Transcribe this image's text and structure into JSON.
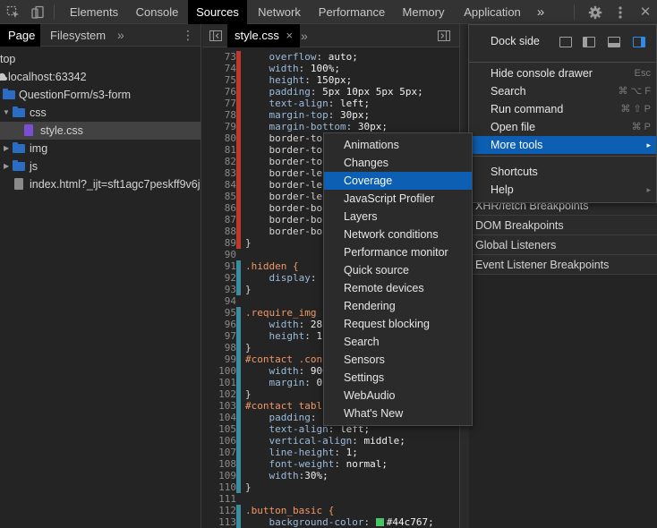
{
  "toolbar": {
    "inspect_icon": "cursor-inspect-icon",
    "device_icon": "device-toggle-icon",
    "tabs": [
      "Elements",
      "Console",
      "Sources",
      "Network",
      "Performance",
      "Memory",
      "Application"
    ],
    "active_tab": "Sources",
    "more_tabs": "»",
    "settings_icon": "gear-icon",
    "kebab_icon": "vertical-dots-icon",
    "close_icon": "close-icon",
    "close_glyph": "✕"
  },
  "navigator": {
    "tabs": [
      "Page",
      "Filesystem"
    ],
    "active_tab": "Page",
    "more": "»",
    "menu": "⋮",
    "tree": [
      {
        "label": "top",
        "level": 0,
        "kind": "frame"
      },
      {
        "label": "localhost:63342",
        "level": 0,
        "kind": "cloud"
      },
      {
        "label": "QuestionForm/s3-form",
        "level": 0,
        "kind": "folder"
      },
      {
        "label": "css",
        "level": 0,
        "kind": "folder",
        "open": true
      },
      {
        "label": "style.css",
        "level": 1,
        "kind": "css-file",
        "selected": true
      },
      {
        "label": "img",
        "level": 0,
        "kind": "folder",
        "open": false
      },
      {
        "label": "js",
        "level": 0,
        "kind": "folder",
        "open": false
      },
      {
        "label": "index.html?_ijt=sft1agc7peskff9v6j3",
        "level": 0,
        "kind": "html-file"
      }
    ]
  },
  "editor": {
    "tab_label": "style.css",
    "tab_close": "×",
    "lines": [
      {
        "n": "73",
        "cov": "red",
        "text": "    overflow: auto;"
      },
      {
        "n": "74",
        "cov": "red",
        "text": "    width: 100%;"
      },
      {
        "n": "75",
        "cov": "red",
        "text": "    height: 150px;"
      },
      {
        "n": "76",
        "cov": "red",
        "text": "    padding: 5px 10px 5px 5px;"
      },
      {
        "n": "77",
        "cov": "red",
        "text": "    text-align: left;"
      },
      {
        "n": "78",
        "cov": "red",
        "text": "    margin-top: 30px;"
      },
      {
        "n": "79",
        "cov": "red",
        "text": "    margin-bottom: 30px;"
      },
      {
        "n": "80",
        "cov": "red",
        "text": "    border-to"
      },
      {
        "n": "81",
        "cov": "red",
        "text": "    border-to"
      },
      {
        "n": "82",
        "cov": "red",
        "text": "    border-to"
      },
      {
        "n": "83",
        "cov": "red",
        "text": "    border-le"
      },
      {
        "n": "84",
        "cov": "red",
        "text": "    border-le"
      },
      {
        "n": "85",
        "cov": "red",
        "text": "    border-le"
      },
      {
        "n": "86",
        "cov": "red",
        "text": "    border-bo"
      },
      {
        "n": "87",
        "cov": "red",
        "text": "    border-bo"
      },
      {
        "n": "88",
        "cov": "red",
        "text": "    border-bo"
      },
      {
        "n": "89",
        "cov": "red",
        "text": "}"
      },
      {
        "n": "90",
        "cov": "none",
        "text": ""
      },
      {
        "n": "91",
        "cov": "green",
        "text": ".hidden {"
      },
      {
        "n": "92",
        "cov": "green",
        "text": "    display:"
      },
      {
        "n": "93",
        "cov": "green",
        "text": "}"
      },
      {
        "n": "94",
        "cov": "none",
        "text": ""
      },
      {
        "n": "95",
        "cov": "green",
        "text": ".require_img"
      },
      {
        "n": "96",
        "cov": "green",
        "text": "    width: 28"
      },
      {
        "n": "97",
        "cov": "green",
        "text": "    height: 1"
      },
      {
        "n": "98",
        "cov": "green",
        "text": "}"
      },
      {
        "n": "99",
        "cov": "green",
        "text": "#contact .con"
      },
      {
        "n": "100",
        "cov": "green",
        "text": "    width: 900"
      },
      {
        "n": "101",
        "cov": "green",
        "text": "    margin: 0"
      },
      {
        "n": "102",
        "cov": "green",
        "text": "}"
      },
      {
        "n": "103",
        "cov": "green",
        "text": "#contact tabl"
      },
      {
        "n": "104",
        "cov": "green",
        "text": "    padding:"
      },
      {
        "n": "105",
        "cov": "green",
        "text": "    text-align: left;"
      },
      {
        "n": "106",
        "cov": "green",
        "text": "    vertical-align: middle;"
      },
      {
        "n": "107",
        "cov": "green",
        "text": "    line-height: 1;"
      },
      {
        "n": "108",
        "cov": "green",
        "text": "    font-weight: normal;"
      },
      {
        "n": "109",
        "cov": "green",
        "text": "    width:30%;"
      },
      {
        "n": "110",
        "cov": "green",
        "text": "}"
      },
      {
        "n": "111",
        "cov": "none",
        "text": ""
      },
      {
        "n": "112",
        "cov": "green",
        "text": ".button_basic {"
      },
      {
        "n": "113",
        "cov": "green",
        "text": "    background-color: "
      }
    ],
    "line_113_swatch": "#44c767",
    "line_113_value": "#44c767;"
  },
  "right_pane": {
    "items": [
      "XHR/fetch Breakpoints",
      "DOM Breakpoints",
      "Global Listeners",
      "Event Listener Breakpoints"
    ]
  },
  "main_menu": {
    "dock_side_label": "Dock side",
    "dock_icons": [
      "dock-undock-icon",
      "dock-left-icon",
      "dock-bottom-icon",
      "dock-right-icon"
    ],
    "items": [
      {
        "label": "Hide console drawer",
        "shortcut": "Esc"
      },
      {
        "label": "Search",
        "shortcut": "⌘ ⌥ F"
      },
      {
        "label": "Run command",
        "shortcut": "⌘ ⇧ P"
      },
      {
        "label": "Open file",
        "shortcut": "⌘ P"
      },
      {
        "label": "More tools",
        "shortcut": "▸",
        "highlighted": true
      },
      {
        "label": "Shortcuts",
        "shortcut": ""
      },
      {
        "label": "Help",
        "shortcut": "▸"
      }
    ]
  },
  "more_tools_menu": {
    "items": [
      "Animations",
      "Changes",
      "Coverage",
      "JavaScript Profiler",
      "Layers",
      "Network conditions",
      "Performance monitor",
      "Quick source",
      "Remote devices",
      "Rendering",
      "Request blocking",
      "Search",
      "Sensors",
      "Settings",
      "WebAudio",
      "What's New"
    ],
    "highlighted": "Coverage"
  },
  "colors": {
    "accent": "#0d5fb3",
    "coverage_unused": "#c0392b",
    "coverage_used": "#3a8c9f"
  }
}
